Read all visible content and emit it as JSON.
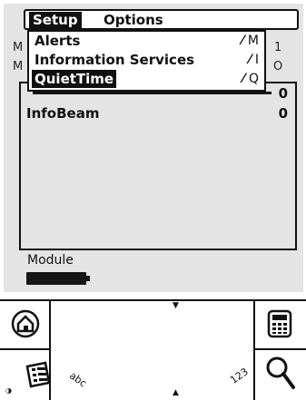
{
  "menubar": {
    "menus": [
      {
        "label": "Setup"
      },
      {
        "label": "Options"
      }
    ]
  },
  "dropdown": {
    "items": [
      {
        "label": "Alerts",
        "shortcut": "M"
      },
      {
        "label": "Information Services",
        "shortcut": "I"
      },
      {
        "label": "QuietTime",
        "shortcut": "Q"
      }
    ]
  },
  "background": {
    "stray": [
      "M",
      "1",
      "M",
      "O"
    ],
    "rows": [
      {
        "name": "",
        "value": "0"
      },
      {
        "name": "InfoBeam",
        "value": "0"
      }
    ],
    "module_label": "Module"
  },
  "silkscreen": {
    "abc_label": "abc",
    "num_label": "123",
    "icons": [
      "home-icon",
      "calculator-icon",
      "menu-icon",
      "find-icon"
    ]
  }
}
